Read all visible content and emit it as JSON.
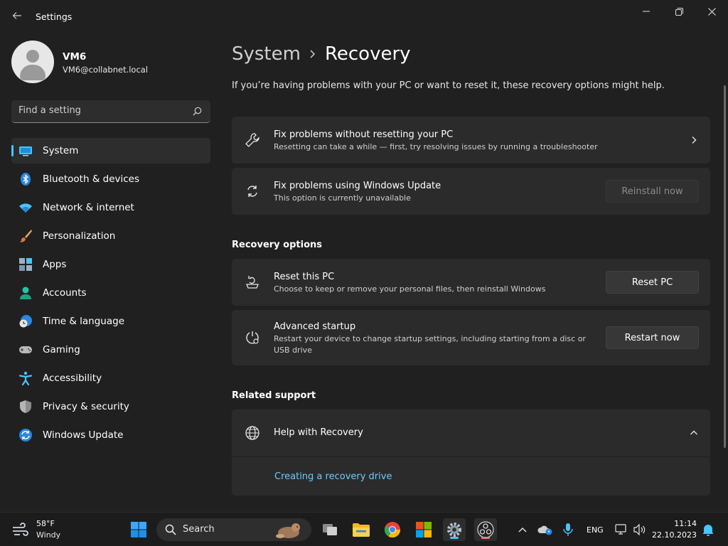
{
  "window": {
    "title": "Settings"
  },
  "profile": {
    "name": "VM6",
    "email": "VM6@collabnet.local"
  },
  "search": {
    "placeholder": "Find a setting"
  },
  "sidebar": {
    "items": [
      {
        "label": "System",
        "icon": "system-icon",
        "active": true
      },
      {
        "label": "Bluetooth & devices",
        "icon": "bluetooth-icon"
      },
      {
        "label": "Network & internet",
        "icon": "wifi-icon"
      },
      {
        "label": "Personalization",
        "icon": "brush-icon"
      },
      {
        "label": "Apps",
        "icon": "apps-icon"
      },
      {
        "label": "Accounts",
        "icon": "accounts-icon"
      },
      {
        "label": "Time & language",
        "icon": "clock-globe-icon"
      },
      {
        "label": "Gaming",
        "icon": "gamepad-icon"
      },
      {
        "label": "Accessibility",
        "icon": "accessibility-icon"
      },
      {
        "label": "Privacy & security",
        "icon": "shield-icon"
      },
      {
        "label": "Windows Update",
        "icon": "update-icon"
      }
    ]
  },
  "main": {
    "breadcrumb_parent": "System",
    "breadcrumb_current": "Recovery",
    "intro": "If you’re having problems with your PC or want to reset it, these recovery options might help.",
    "fix_no_reset": {
      "title": "Fix problems without resetting your PC",
      "description": "Resetting can take a while — first, try resolving issues by running a troubleshooter"
    },
    "fix_update": {
      "title": "Fix problems using Windows Update",
      "description": "This option is currently unavailable",
      "button": "Reinstall now"
    },
    "recovery_options_title": "Recovery options",
    "reset_pc": {
      "title": "Reset this PC",
      "description": "Choose to keep or remove your personal files, then reinstall Windows",
      "button": "Reset PC"
    },
    "advanced_startup": {
      "title": "Advanced startup",
      "description": "Restart your device to change startup settings, including starting from a disc or USB drive",
      "button": "Restart now"
    },
    "related_support_title": "Related support",
    "help_recovery": {
      "title": "Help with Recovery",
      "link": "Creating a recovery drive"
    }
  },
  "taskbar": {
    "weather_temp": "58°F",
    "weather_desc": "Windy",
    "search_label": "Search",
    "language": "ENG",
    "time": "11:14",
    "date": "22.10.2023"
  },
  "colors": {
    "accent": "#4cc2ff",
    "link": "#6ccbff",
    "background": "#202020",
    "card": "#2b2b2b"
  }
}
